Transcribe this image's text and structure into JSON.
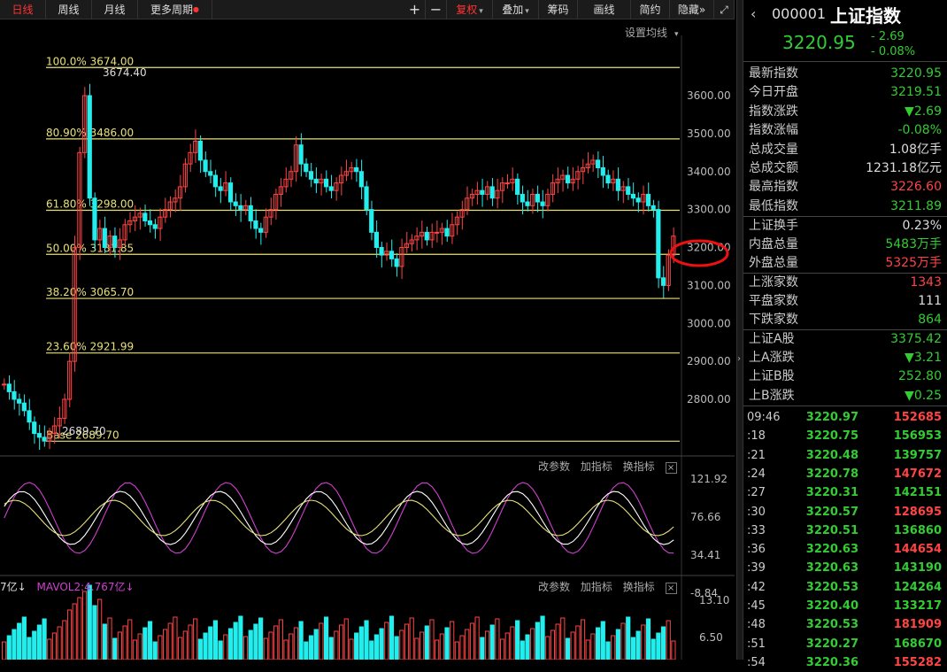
{
  "toolbar": {
    "periods": [
      "日线",
      "周线",
      "月线",
      "更多周期"
    ],
    "active": "日线",
    "plus": "+",
    "minus": "−",
    "fuquan": "复权",
    "overlay": "叠加",
    "chips": "筹码",
    "draw": "画线",
    "simple": "简约",
    "hide": "隐藏",
    "hide_arrow": "»",
    "fullscreen": "⤢"
  },
  "main_chart": {
    "settings_label": "设置均线",
    "price_axis": [
      "3600.00",
      "3500.00",
      "3400.00",
      "3300.00",
      "3200.00",
      "3100.00",
      "3000.00",
      "2900.00",
      "2800.00"
    ],
    "fib_labels": [
      "100.0% 3674.00",
      "80.90% 3486.00",
      "61.80% 3298.00",
      "50.00% 3181.85",
      "38.20% 3065.70",
      "23.60% 2921.99",
      "Base 2689.70"
    ],
    "high_label": "3674.40",
    "low_label": "2689.70",
    "marker_text": "3181"
  },
  "osc": {
    "links": [
      "改参数",
      "加指标",
      "换指标"
    ],
    "close": "×",
    "axis": [
      "121.92",
      "76.66",
      "34.41",
      "-8.84"
    ]
  },
  "vol": {
    "legend_a": "7亿↓",
    "legend_b": "MAVOL2:4.767亿↓",
    "links": [
      "改参数",
      "加指标",
      "换指标"
    ],
    "close": "×",
    "axis": [
      "13.10",
      "6.50"
    ]
  },
  "quote": {
    "code": "000001",
    "name": "上证指数",
    "price": "3220.95",
    "change": "- 2.69",
    "pct": "- 0.08%"
  },
  "stats": [
    {
      "k": "最新指数",
      "v": "3220.95",
      "c": "#3c3"
    },
    {
      "k": "今日开盘",
      "v": "3219.51",
      "c": "#3c3"
    },
    {
      "k": "指数涨跌",
      "v": "▼2.69",
      "c": "#3c3"
    },
    {
      "k": "指数涨幅",
      "v": "-0.08%",
      "c": "#3c3"
    },
    {
      "k": "总成交量",
      "v": "1.08亿手",
      "c": "#ddd"
    },
    {
      "k": "总成交额",
      "v": "1231.18亿元",
      "c": "#ddd"
    },
    {
      "k": "最高指数",
      "v": "3226.60",
      "c": "#f44"
    },
    {
      "k": "最低指数",
      "v": "3211.89",
      "c": "#3c3"
    },
    {
      "k": "上证换手",
      "v": "0.23%",
      "c": "#ddd"
    },
    {
      "k": "内盘总量",
      "v": "5483万手",
      "c": "#3c3"
    },
    {
      "k": "外盘总量",
      "v": "5325万手",
      "c": "#f44"
    },
    {
      "k": "上涨家数",
      "v": "1343",
      "c": "#f44"
    },
    {
      "k": "平盘家数",
      "v": "111",
      "c": "#ddd"
    },
    {
      "k": "下跌家数",
      "v": "864",
      "c": "#3c3"
    },
    {
      "k": "上证A股",
      "v": "3375.42",
      "c": "#3c3"
    },
    {
      "k": "上A涨跌",
      "v": "▼3.21",
      "c": "#3c3"
    },
    {
      "k": "上证B股",
      "v": "252.80",
      "c": "#3c3"
    },
    {
      "k": "上B涨跌",
      "v": "▼0.25",
      "c": "#3c3"
    }
  ],
  "ticks": [
    {
      "t": "09:46",
      "p": "3220.97",
      "v": "152685",
      "c": "#f44"
    },
    {
      "t": ":18",
      "p": "3220.75",
      "v": "156953",
      "c": "#3c3"
    },
    {
      "t": ":21",
      "p": "3220.48",
      "v": "139757",
      "c": "#3c3"
    },
    {
      "t": ":24",
      "p": "3220.78",
      "v": "147672",
      "c": "#f44"
    },
    {
      "t": ":27",
      "p": "3220.31",
      "v": "142151",
      "c": "#3c3"
    },
    {
      "t": ":30",
      "p": "3220.57",
      "v": "128695",
      "c": "#f44"
    },
    {
      "t": ":33",
      "p": "3220.51",
      "v": "136860",
      "c": "#3c3"
    },
    {
      "t": ":36",
      "p": "3220.63",
      "v": "144654",
      "c": "#f44"
    },
    {
      "t": ":39",
      "p": "3220.63",
      "v": "143190",
      "c": "#3c3"
    },
    {
      "t": ":42",
      "p": "3220.53",
      "v": "124264",
      "c": "#3c3"
    },
    {
      "t": ":45",
      "p": "3220.40",
      "v": "133217",
      "c": "#3c3"
    },
    {
      "t": ":48",
      "p": "3220.53",
      "v": "181909",
      "c": "#f44"
    },
    {
      "t": ":51",
      "p": "3220.27",
      "v": "168670",
      "c": "#3c3"
    },
    {
      "t": ":54",
      "p": "3220.36",
      "v": "155282",
      "c": "#f44"
    }
  ],
  "chart_data": {
    "type": "candlestick",
    "fib_levels": [
      3674.0,
      3486.0,
      3298.0,
      3181.85,
      3065.7,
      2921.99,
      2689.7
    ],
    "closes": [
      2840,
      2820,
      2800,
      2790,
      2770,
      2740,
      2710,
      2700,
      2690,
      2710,
      2730,
      2750,
      2800,
      2900,
      3200,
      3450,
      3600,
      3330,
      3220,
      3250,
      3200,
      3230,
      3200,
      3220,
      3260,
      3270,
      3280,
      3290,
      3270,
      3260,
      3250,
      3280,
      3300,
      3320,
      3330,
      3360,
      3420,
      3450,
      3480,
      3430,
      3400,
      3390,
      3360,
      3350,
      3370,
      3320,
      3310,
      3300,
      3310,
      3270,
      3250,
      3240,
      3280,
      3300,
      3340,
      3360,
      3380,
      3400,
      3470,
      3420,
      3400,
      3380,
      3370,
      3380,
      3360,
      3350,
      3370,
      3390,
      3400,
      3410,
      3400,
      3360,
      3300,
      3240,
      3200,
      3180,
      3190,
      3170,
      3150,
      3200,
      3210,
      3220,
      3230,
      3240,
      3220,
      3240,
      3240,
      3250,
      3230,
      3260,
      3280,
      3300,
      3330,
      3340,
      3350,
      3340,
      3360,
      3330,
      3350,
      3370,
      3370,
      3380,
      3340,
      3320,
      3310,
      3340,
      3320,
      3310,
      3340,
      3370,
      3380,
      3390,
      3370,
      3380,
      3400,
      3410,
      3420,
      3430,
      3410,
      3390,
      3370,
      3380,
      3350,
      3360,
      3340,
      3330,
      3320,
      3340,
      3310,
      3300,
      3120,
      3100,
      3180,
      3230
    ]
  }
}
